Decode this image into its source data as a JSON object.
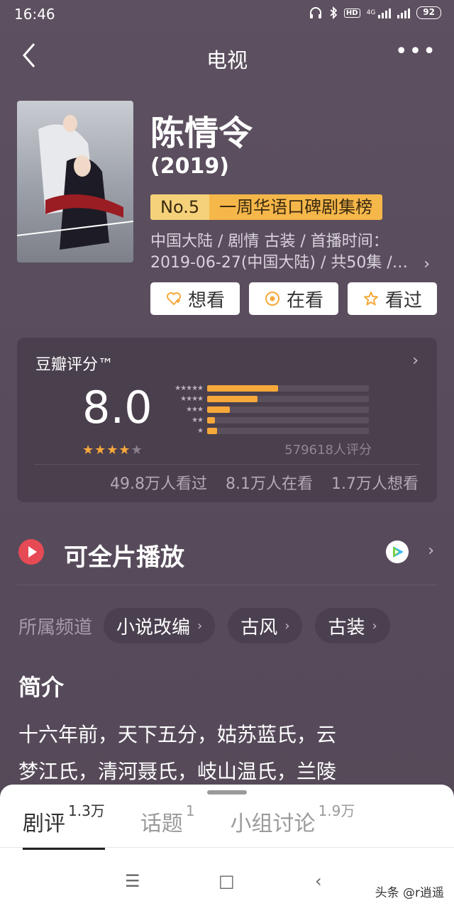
{
  "status": {
    "time": "16:46",
    "battery": "92",
    "network": "4G"
  },
  "nav": {
    "title": "电视"
  },
  "movie": {
    "title": "陈情令",
    "year": "(2019)",
    "rank_no": "No.5",
    "rank_text": "一周华语口碑剧集榜",
    "meta_line1": "中国大陆 / 剧情 古装 / 首播时间：",
    "meta_line2": "2019-06-27(中国大陆) / 共50集 /…"
  },
  "actions": [
    {
      "label": "想看",
      "icon": "heart-plus-icon"
    },
    {
      "label": "在看",
      "icon": "target-icon"
    },
    {
      "label": "看过",
      "icon": "star-outline-icon"
    }
  ],
  "rating": {
    "label": "豆瓣评分™",
    "score": "8.0",
    "stars_filled": 4,
    "stars_total": 5,
    "count_text": "579618人评分",
    "distribution": [
      0.44,
      0.31,
      0.14,
      0.05,
      0.06
    ],
    "stats": [
      "49.8万人看过",
      "8.1万人在看",
      "1.7万人想看"
    ]
  },
  "play": {
    "label": "可全片播放",
    "provider_icon": "tencent-video-icon"
  },
  "channels": {
    "label": "所属频道",
    "items": [
      "小说改编",
      "古风",
      "古装"
    ]
  },
  "synopsis": {
    "title": "简介",
    "line1": "十六年前，天下五分，姑苏蓝氏，云",
    "line2": "梦江氏，清河聂氏，岐山温氏，兰陵"
  },
  "tabs": [
    {
      "label": "剧评",
      "count": "1.3万"
    },
    {
      "label": "话题",
      "count": "1"
    },
    {
      "label": "小组讨论",
      "count": "1.9万"
    }
  ],
  "watermark": "头条 @r逍遥",
  "colors": {
    "accent": "#f6a83a",
    "play_red": "#e64a55",
    "background": "#5a4e5e"
  }
}
